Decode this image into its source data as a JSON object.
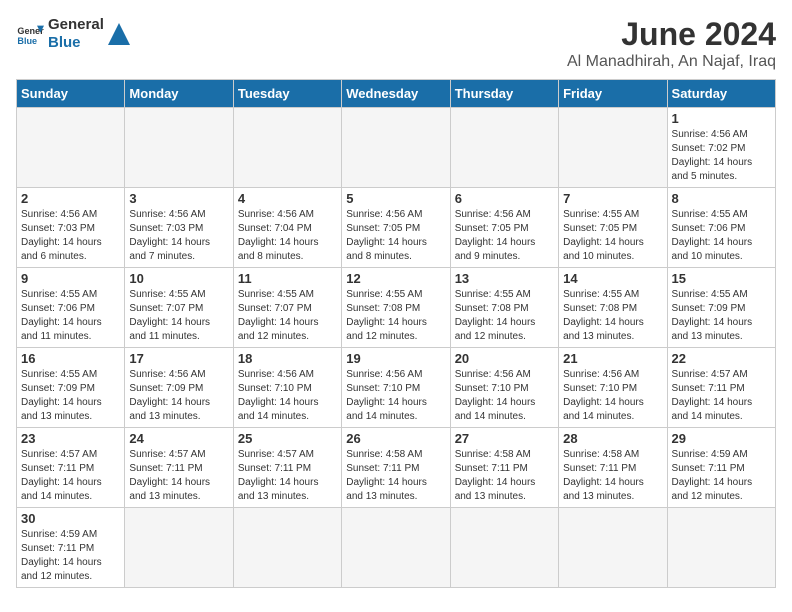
{
  "header": {
    "logo_general": "General",
    "logo_blue": "Blue",
    "title": "June 2024",
    "location": "Al Manadhirah, An Najaf, Iraq"
  },
  "weekdays": [
    "Sunday",
    "Monday",
    "Tuesday",
    "Wednesday",
    "Thursday",
    "Friday",
    "Saturday"
  ],
  "weeks": [
    [
      {
        "day": "",
        "empty": true
      },
      {
        "day": "",
        "empty": true
      },
      {
        "day": "",
        "empty": true
      },
      {
        "day": "",
        "empty": true
      },
      {
        "day": "",
        "empty": true
      },
      {
        "day": "",
        "empty": true
      },
      {
        "day": "1",
        "sunrise": "4:56 AM",
        "sunset": "7:02 PM",
        "daylight": "14 hours and 5 minutes."
      }
    ],
    [
      {
        "day": "2",
        "sunrise": "4:56 AM",
        "sunset": "7:03 PM",
        "daylight": "14 hours and 6 minutes."
      },
      {
        "day": "3",
        "sunrise": "4:56 AM",
        "sunset": "7:03 PM",
        "daylight": "14 hours and 7 minutes."
      },
      {
        "day": "4",
        "sunrise": "4:56 AM",
        "sunset": "7:04 PM",
        "daylight": "14 hours and 8 minutes."
      },
      {
        "day": "5",
        "sunrise": "4:56 AM",
        "sunset": "7:05 PM",
        "daylight": "14 hours and 8 minutes."
      },
      {
        "day": "6",
        "sunrise": "4:56 AM",
        "sunset": "7:05 PM",
        "daylight": "14 hours and 9 minutes."
      },
      {
        "day": "7",
        "sunrise": "4:55 AM",
        "sunset": "7:05 PM",
        "daylight": "14 hours and 10 minutes."
      },
      {
        "day": "8",
        "sunrise": "4:55 AM",
        "sunset": "7:06 PM",
        "daylight": "14 hours and 10 minutes."
      }
    ],
    [
      {
        "day": "9",
        "sunrise": "4:55 AM",
        "sunset": "7:06 PM",
        "daylight": "14 hours and 11 minutes."
      },
      {
        "day": "10",
        "sunrise": "4:55 AM",
        "sunset": "7:07 PM",
        "daylight": "14 hours and 11 minutes."
      },
      {
        "day": "11",
        "sunrise": "4:55 AM",
        "sunset": "7:07 PM",
        "daylight": "14 hours and 12 minutes."
      },
      {
        "day": "12",
        "sunrise": "4:55 AM",
        "sunset": "7:08 PM",
        "daylight": "14 hours and 12 minutes."
      },
      {
        "day": "13",
        "sunrise": "4:55 AM",
        "sunset": "7:08 PM",
        "daylight": "14 hours and 12 minutes."
      },
      {
        "day": "14",
        "sunrise": "4:55 AM",
        "sunset": "7:08 PM",
        "daylight": "14 hours and 13 minutes."
      },
      {
        "day": "15",
        "sunrise": "4:55 AM",
        "sunset": "7:09 PM",
        "daylight": "14 hours and 13 minutes."
      }
    ],
    [
      {
        "day": "16",
        "sunrise": "4:55 AM",
        "sunset": "7:09 PM",
        "daylight": "14 hours and 13 minutes."
      },
      {
        "day": "17",
        "sunrise": "4:56 AM",
        "sunset": "7:09 PM",
        "daylight": "14 hours and 13 minutes."
      },
      {
        "day": "18",
        "sunrise": "4:56 AM",
        "sunset": "7:10 PM",
        "daylight": "14 hours and 14 minutes."
      },
      {
        "day": "19",
        "sunrise": "4:56 AM",
        "sunset": "7:10 PM",
        "daylight": "14 hours and 14 minutes."
      },
      {
        "day": "20",
        "sunrise": "4:56 AM",
        "sunset": "7:10 PM",
        "daylight": "14 hours and 14 minutes."
      },
      {
        "day": "21",
        "sunrise": "4:56 AM",
        "sunset": "7:10 PM",
        "daylight": "14 hours and 14 minutes."
      },
      {
        "day": "22",
        "sunrise": "4:57 AM",
        "sunset": "7:11 PM",
        "daylight": "14 hours and 14 minutes."
      }
    ],
    [
      {
        "day": "23",
        "sunrise": "4:57 AM",
        "sunset": "7:11 PM",
        "daylight": "14 hours and 14 minutes."
      },
      {
        "day": "24",
        "sunrise": "4:57 AM",
        "sunset": "7:11 PM",
        "daylight": "14 hours and 13 minutes."
      },
      {
        "day": "25",
        "sunrise": "4:57 AM",
        "sunset": "7:11 PM",
        "daylight": "14 hours and 13 minutes."
      },
      {
        "day": "26",
        "sunrise": "4:58 AM",
        "sunset": "7:11 PM",
        "daylight": "14 hours and 13 minutes."
      },
      {
        "day": "27",
        "sunrise": "4:58 AM",
        "sunset": "7:11 PM",
        "daylight": "14 hours and 13 minutes."
      },
      {
        "day": "28",
        "sunrise": "4:58 AM",
        "sunset": "7:11 PM",
        "daylight": "14 hours and 13 minutes."
      },
      {
        "day": "29",
        "sunrise": "4:59 AM",
        "sunset": "7:11 PM",
        "daylight": "14 hours and 12 minutes."
      }
    ],
    [
      {
        "day": "30",
        "sunrise": "4:59 AM",
        "sunset": "7:11 PM",
        "daylight": "14 hours and 12 minutes."
      },
      {
        "day": "",
        "empty": true
      },
      {
        "day": "",
        "empty": true
      },
      {
        "day": "",
        "empty": true
      },
      {
        "day": "",
        "empty": true
      },
      {
        "day": "",
        "empty": true
      },
      {
        "day": "",
        "empty": true
      }
    ]
  ],
  "labels": {
    "sunrise": "Sunrise:",
    "sunset": "Sunset:",
    "daylight": "Daylight:"
  }
}
